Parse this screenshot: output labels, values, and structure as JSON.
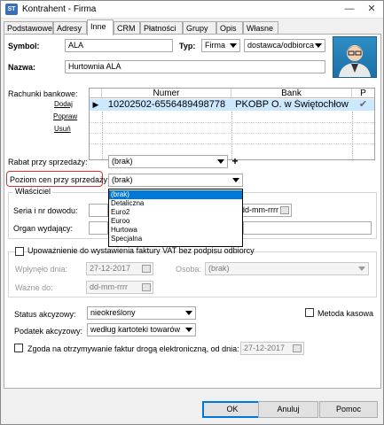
{
  "window": {
    "title": "Kontrahent - Firma",
    "app_icon": "ST"
  },
  "tabs": [
    "Podstawowe",
    "Adresy",
    "Inne",
    "CRM",
    "Płatności",
    "Grupy",
    "Opis",
    "Własne"
  ],
  "active_tab": "Inne",
  "header": {
    "symbol_label": "Symbol:",
    "symbol_value": "ALA",
    "typ_label": "Typ:",
    "typ_value": "Firma",
    "typ2_value": "dostawca/odbiorca",
    "nazwa_label": "Nazwa:",
    "nazwa_value": "Hurtownia ALA"
  },
  "bank": {
    "section_label": "Rachunki bankowe:",
    "actions": [
      "Dodaj",
      "Popraw",
      "Usuń"
    ],
    "columns": [
      "Numer",
      "Bank",
      "P"
    ],
    "rows": [
      {
        "numer": "10202502-6556489498778",
        "bank": "PKOBP O. w Świętochłow",
        "p": "✔"
      }
    ]
  },
  "rabat": {
    "label": "Rabat przy sprzedaży:",
    "value": "(brak)"
  },
  "poziom": {
    "label": "Poziom cen przy sprzedaży:",
    "value": "(brak)",
    "options": [
      "(brak)",
      "Detaliczna",
      "Euro2",
      "Euroo",
      "Hurtowa",
      "Specjalna"
    ],
    "selected": "(brak)"
  },
  "wlasciciel": {
    "title": "Właściciel",
    "seria_label": "Seria i nr dowodu:",
    "organ_label": "Organ wydający:",
    "date_value": "dd-mm-rrrr"
  },
  "upowaznienie": {
    "label": "Upoważnienie do wystawienia faktury VAT bez podpisu odbiorcy",
    "wplynelo_label": "Wpłynęło dnia:",
    "wplynelo_value": "27-12-2017",
    "osoba_label": "Osoba:",
    "osoba_value": "(brak)",
    "wazne_label": "Ważne do:",
    "wazne_value": "dd-mm-rrrr"
  },
  "status": {
    "status_label": "Status akcyzowy:",
    "status_value": "nieokreślony",
    "metoda_label": "Metoda kasowa",
    "podatek_label": "Podatek akcyzowy:",
    "podatek_value": "według kartoteki towarów",
    "zgoda_label": "Zgoda na otrzymywanie faktur drogą elektroniczną, od dnia:",
    "zgoda_date": "27-12-2017"
  },
  "buttons": {
    "ok": "OK",
    "cancel": "Anuluj",
    "help": "Pomoc"
  },
  "colors": {
    "highlight": "#e03030",
    "selection": "#0078d7",
    "grid_row": "#cce8ff"
  }
}
